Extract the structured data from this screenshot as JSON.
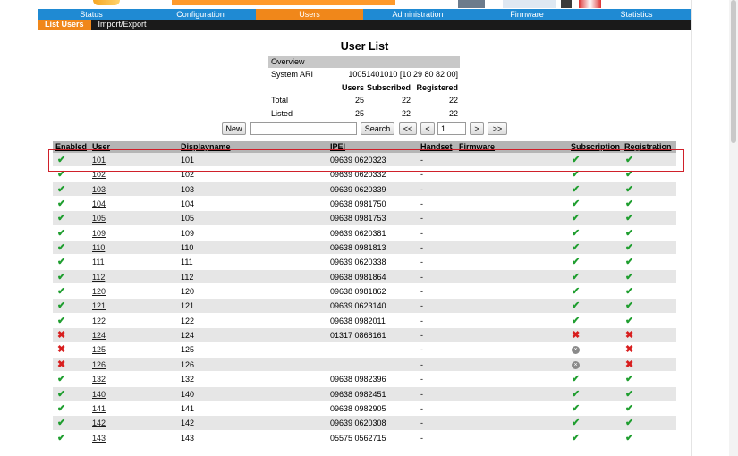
{
  "nav": {
    "tabs": [
      {
        "label": "Status",
        "active": false
      },
      {
        "label": "Configuration",
        "active": false
      },
      {
        "label": "Users",
        "active": true
      },
      {
        "label": "Administration",
        "active": false
      },
      {
        "label": "Firmware",
        "active": false
      },
      {
        "label": "Statistics",
        "active": false
      }
    ],
    "subtabs": [
      {
        "label": "List Users",
        "active": true
      },
      {
        "label": "Import/Export",
        "active": false
      }
    ]
  },
  "title": "User List",
  "overview": {
    "header": "Overview",
    "ari_label": "System ARI",
    "ari_value": "10051401010 [10 29 80 82 00]",
    "col_users": "Users",
    "col_subscribed": "Subscribed",
    "col_registered": "Registered",
    "total_label": "Total",
    "total": [
      "25",
      "22",
      "22"
    ],
    "listed_label": "Listed",
    "listed": [
      "25",
      "22",
      "22"
    ]
  },
  "controls": {
    "new_label": "New",
    "search_value": "",
    "search_label": "Search",
    "first_label": "<<",
    "prev_label": "<",
    "page_value": "1",
    "next_label": ">",
    "last_label": ">>"
  },
  "columns": [
    "Enabled",
    "User",
    "Displayname",
    "IPEI",
    "Handset",
    "Firmware",
    "Subscription",
    "Registration"
  ],
  "status_colors": {
    "ok": "#1f9e2f",
    "bad": "#d81e1e",
    "na": "#8a8a8a"
  },
  "rows": [
    {
      "enabled": "ok",
      "user": "101",
      "display": "101",
      "ipei": "09639 0620323",
      "handset": "-",
      "sub": "ok",
      "reg": "ok"
    },
    {
      "enabled": "ok",
      "user": "102",
      "display": "102",
      "ipei": "09639 0620332",
      "handset": "-",
      "sub": "ok",
      "reg": "ok"
    },
    {
      "enabled": "ok",
      "user": "103",
      "display": "103",
      "ipei": "09639 0620339",
      "handset": "-",
      "sub": "ok",
      "reg": "ok"
    },
    {
      "enabled": "ok",
      "user": "104",
      "display": "104",
      "ipei": "09638 0981750",
      "handset": "-",
      "sub": "ok",
      "reg": "ok"
    },
    {
      "enabled": "ok",
      "user": "105",
      "display": "105",
      "ipei": "09638 0981753",
      "handset": "-",
      "sub": "ok",
      "reg": "ok"
    },
    {
      "enabled": "ok",
      "user": "109",
      "display": "109",
      "ipei": "09639 0620381",
      "handset": "-",
      "sub": "ok",
      "reg": "ok"
    },
    {
      "enabled": "ok",
      "user": "110",
      "display": "110",
      "ipei": "09638 0981813",
      "handset": "-",
      "sub": "ok",
      "reg": "ok"
    },
    {
      "enabled": "ok",
      "user": "111",
      "display": "111",
      "ipei": "09639 0620338",
      "handset": "-",
      "sub": "ok",
      "reg": "ok"
    },
    {
      "enabled": "ok",
      "user": "112",
      "display": "112",
      "ipei": "09638 0981864",
      "handset": "-",
      "sub": "ok",
      "reg": "ok"
    },
    {
      "enabled": "ok",
      "user": "120",
      "display": "120",
      "ipei": "09638 0981862",
      "handset": "-",
      "sub": "ok",
      "reg": "ok"
    },
    {
      "enabled": "ok",
      "user": "121",
      "display": "121",
      "ipei": "09639 0623140",
      "handset": "-",
      "sub": "ok",
      "reg": "ok"
    },
    {
      "enabled": "ok",
      "user": "122",
      "display": "122",
      "ipei": "09638 0982011",
      "handset": "-",
      "sub": "ok",
      "reg": "ok"
    },
    {
      "enabled": "bad",
      "user": "124",
      "display": "124",
      "ipei": "01317 0868161",
      "handset": "-",
      "sub": "bad",
      "reg": "bad"
    },
    {
      "enabled": "bad",
      "user": "125",
      "display": "125",
      "ipei": "",
      "handset": "-",
      "sub": "na",
      "reg": "bad"
    },
    {
      "enabled": "bad",
      "user": "126",
      "display": "126",
      "ipei": "",
      "handset": "-",
      "sub": "na",
      "reg": "bad"
    },
    {
      "enabled": "ok",
      "user": "132",
      "display": "132",
      "ipei": "09638 0982396",
      "handset": "-",
      "sub": "ok",
      "reg": "ok"
    },
    {
      "enabled": "ok",
      "user": "140",
      "display": "140",
      "ipei": "09638 0982451",
      "handset": "-",
      "sub": "ok",
      "reg": "ok"
    },
    {
      "enabled": "ok",
      "user": "141",
      "display": "141",
      "ipei": "09638 0982905",
      "handset": "-",
      "sub": "ok",
      "reg": "ok"
    },
    {
      "enabled": "ok",
      "user": "142",
      "display": "142",
      "ipei": "09639 0620308",
      "handset": "-",
      "sub": "ok",
      "reg": "ok"
    },
    {
      "enabled": "ok",
      "user": "143",
      "display": "143",
      "ipei": "05575 0562715",
      "handset": "-",
      "sub": "ok",
      "reg": "ok"
    }
  ]
}
